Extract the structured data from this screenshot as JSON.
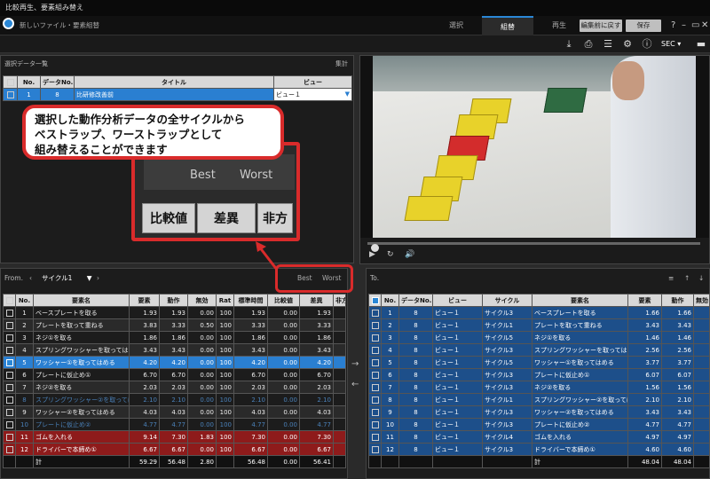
{
  "window": {
    "title": "比較再生、要素組み替え"
  },
  "menubar": {
    "breadcrumb": "新しいファイル・要素組替",
    "tabs": [
      {
        "label": "選択"
      },
      {
        "label": "組替"
      },
      {
        "label": "再生"
      }
    ],
    "active_tab": "組替",
    "undo_label": "編集前に戻す",
    "save_label": "保存",
    "win_controls": [
      "?",
      "–",
      "▭",
      "✕"
    ]
  },
  "toolbar": {
    "unit": "SEC"
  },
  "top_left": {
    "title": "選択データ一覧",
    "right_label": "集計",
    "columns": [
      "",
      "No.",
      "データNo.",
      "タイトル",
      "ビュー"
    ],
    "rows": [
      {
        "no": "1",
        "data_no": "8",
        "title": "比研修改善前",
        "view": "ビュー１"
      }
    ]
  },
  "callout": {
    "lines": [
      "選択した動作分析データの全サイクルから",
      "ベストラップ、ワーストラップとして",
      "組み替えることができます"
    ],
    "zoom_best": "Best",
    "zoom_worst": "Worst",
    "zoom_cells": [
      "比較値",
      "差異",
      "非方"
    ]
  },
  "bottom_left": {
    "from_label": "From.",
    "cycle": "サイクル1",
    "best": "Best",
    "worst": "Worst",
    "columns": [
      "",
      "No.",
      "要素名",
      "要素",
      "動作",
      "無効",
      "Rat",
      "標準時間",
      "比較値",
      "差異",
      "非方"
    ],
    "rows": [
      {
        "no": "1",
        "name": "ベースプレートを取る",
        "el": "1.93",
        "mv": "1.93",
        "inv": "0.00",
        "rat": "100",
        "std": "1.93",
        "cmp": "0.00",
        "diff": "1.93",
        "style": ""
      },
      {
        "no": "2",
        "name": "プレートを取って重ねる",
        "el": "3.83",
        "mv": "3.33",
        "inv": "0.50",
        "rat": "100",
        "std": "3.33",
        "cmp": "0.00",
        "diff": "3.33",
        "style": "alt"
      },
      {
        "no": "3",
        "name": "ネジ①を取る",
        "el": "1.86",
        "mv": "1.86",
        "inv": "0.00",
        "rat": "100",
        "std": "1.86",
        "cmp": "0.00",
        "diff": "1.86",
        "style": ""
      },
      {
        "no": "4",
        "name": "スプリングワッシャーを取ってはめる",
        "el": "3.43",
        "mv": "3.43",
        "inv": "0.00",
        "rat": "100",
        "std": "3.43",
        "cmp": "0.00",
        "diff": "3.43",
        "style": "alt"
      },
      {
        "no": "5",
        "name": "ワッシャー①を取ってはめる",
        "el": "4.20",
        "mv": "4.20",
        "inv": "0.00",
        "rat": "100",
        "std": "4.20",
        "cmp": "0.00",
        "diff": "4.20",
        "style": "sel"
      },
      {
        "no": "6",
        "name": "プレートに仮止め①",
        "el": "6.70",
        "mv": "6.70",
        "inv": "0.00",
        "rat": "100",
        "std": "6.70",
        "cmp": "0.00",
        "diff": "6.70",
        "style": ""
      },
      {
        "no": "7",
        "name": "ネジ②を取る",
        "el": "2.03",
        "mv": "2.03",
        "inv": "0.00",
        "rat": "100",
        "std": "2.03",
        "cmp": "0.00",
        "diff": "2.03",
        "style": "alt"
      },
      {
        "no": "8",
        "name": "スプリングワッシャー②を取ってはめる",
        "el": "2.10",
        "mv": "2.10",
        "inv": "0.00",
        "rat": "100",
        "std": "2.10",
        "cmp": "0.00",
        "diff": "2.10",
        "style": "dim"
      },
      {
        "no": "9",
        "name": "ワッシャー②を取ってはめる",
        "el": "4.03",
        "mv": "4.03",
        "inv": "0.00",
        "rat": "100",
        "std": "4.03",
        "cmp": "0.00",
        "diff": "4.03",
        "style": "alt"
      },
      {
        "no": "10",
        "name": "プレートに仮止め②",
        "el": "4.77",
        "mv": "4.77",
        "inv": "0.00",
        "rat": "100",
        "std": "4.77",
        "cmp": "0.00",
        "diff": "4.77",
        "style": "dim"
      },
      {
        "no": "11",
        "name": "ゴムを入れる",
        "el": "9.14",
        "mv": "7.30",
        "inv": "1.83",
        "rat": "100",
        "std": "7.30",
        "cmp": "0.00",
        "diff": "7.30",
        "style": "red"
      },
      {
        "no": "12",
        "name": "ドライバーで本締め①",
        "el": "6.67",
        "mv": "6.67",
        "inv": "0.00",
        "rat": "100",
        "std": "6.67",
        "cmp": "0.00",
        "diff": "6.67",
        "style": "red"
      }
    ],
    "total": {
      "label": "計",
      "el": "59.29",
      "mv": "56.48",
      "inv": "2.80",
      "std": "56.48",
      "cmp": "0.00",
      "diff": "56.41"
    }
  },
  "bottom_right": {
    "to_label": "To.",
    "columns": [
      "",
      "No.",
      "データNo.",
      "ビュー",
      "サイクル",
      "要素名",
      "要素",
      "動作",
      "無効"
    ],
    "rows": [
      {
        "no": "1",
        "data_no": "8",
        "view": "ビュー１",
        "cycle": "サイクル3",
        "name": "ベースプレートを取る",
        "el": "1.66",
        "mv": "1.66"
      },
      {
        "no": "2",
        "data_no": "8",
        "view": "ビュー１",
        "cycle": "サイクル1",
        "name": "プレートを取って重ねる",
        "el": "3.43",
        "mv": "3.43"
      },
      {
        "no": "3",
        "data_no": "8",
        "view": "ビュー１",
        "cycle": "サイクル5",
        "name": "ネジ①を取る",
        "el": "1.46",
        "mv": "1.46"
      },
      {
        "no": "4",
        "data_no": "8",
        "view": "ビュー１",
        "cycle": "サイクル3",
        "name": "スプリングワッシャーを取ってはめる",
        "el": "2.56",
        "mv": "2.56"
      },
      {
        "no": "5",
        "data_no": "8",
        "view": "ビュー１",
        "cycle": "サイクル5",
        "name": "ワッシャー①を取ってはめる",
        "el": "3.77",
        "mv": "3.77"
      },
      {
        "no": "6",
        "data_no": "8",
        "view": "ビュー１",
        "cycle": "サイクル3",
        "name": "プレートに仮止め①",
        "el": "6.07",
        "mv": "6.07"
      },
      {
        "no": "7",
        "data_no": "8",
        "view": "ビュー１",
        "cycle": "サイクル3",
        "name": "ネジ②を取る",
        "el": "1.56",
        "mv": "1.56"
      },
      {
        "no": "8",
        "data_no": "8",
        "view": "ビュー１",
        "cycle": "サイクル1",
        "name": "スプリングワッシャー②を取ってはめる",
        "el": "2.10",
        "mv": "2.10"
      },
      {
        "no": "9",
        "data_no": "8",
        "view": "ビュー１",
        "cycle": "サイクル3",
        "name": "ワッシャー②を取ってはめる",
        "el": "3.43",
        "mv": "3.43"
      },
      {
        "no": "10",
        "data_no": "8",
        "view": "ビュー１",
        "cycle": "サイクル3",
        "name": "プレートに仮止め②",
        "el": "4.77",
        "mv": "4.77"
      },
      {
        "no": "11",
        "data_no": "8",
        "view": "ビュー１",
        "cycle": "サイクル4",
        "name": "ゴムを入れる",
        "el": "4.97",
        "mv": "4.97"
      },
      {
        "no": "12",
        "data_no": "8",
        "view": "ビュー１",
        "cycle": "サイクル3",
        "name": "ドライバーで本締め①",
        "el": "4.60",
        "mv": "4.60"
      }
    ],
    "total": {
      "label": "計",
      "el": "48.04",
      "mv": "48.04"
    }
  },
  "colors": {
    "accent": "#2a87d6",
    "highlight": "#d92b2b",
    "selected_row": "#2a7fd1",
    "red_row": "#8e1b1b"
  }
}
